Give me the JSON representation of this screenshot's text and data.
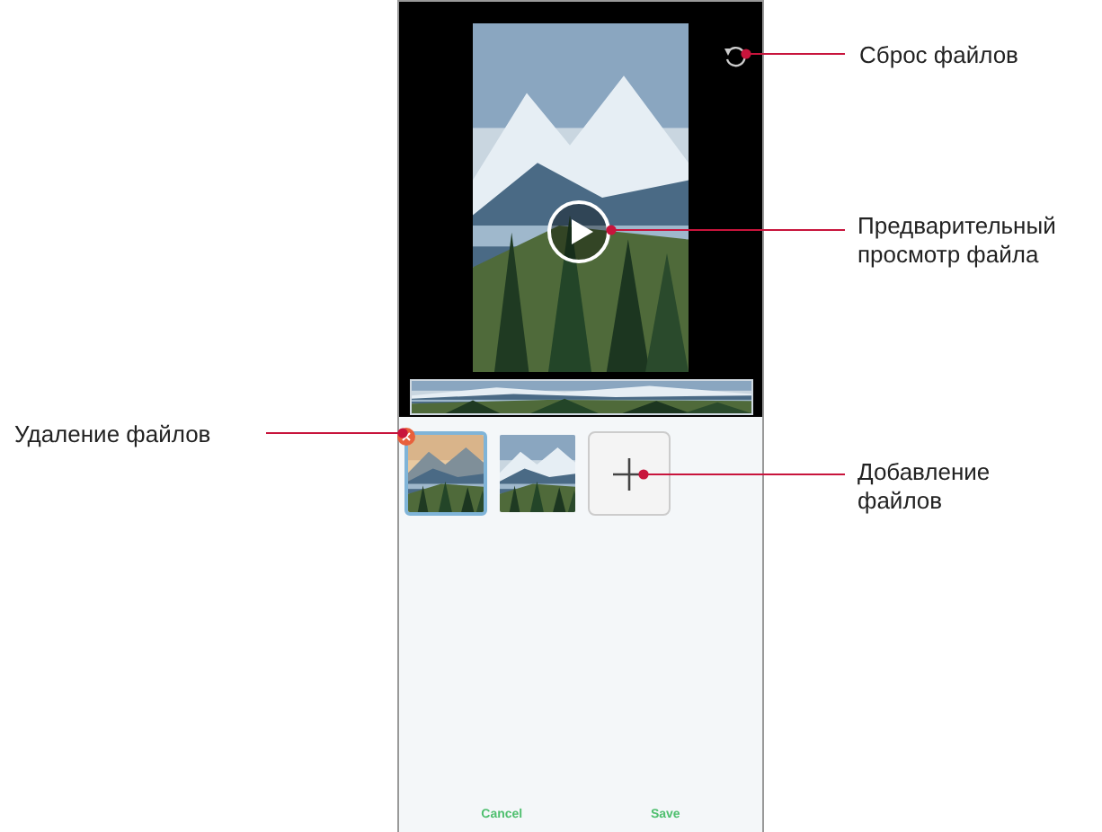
{
  "editor": {
    "files": [
      {
        "kind": "picture",
        "selected": true
      },
      {
        "kind": "picture",
        "selected": false
      }
    ],
    "buttons": [
      {
        "label": "Cancel"
      },
      {
        "label": "Save"
      }
    ]
  },
  "callouts": [
    {
      "text": "Сброс файлов"
    },
    {
      "text": "Предварительный\nпросмотр файла"
    },
    {
      "text": "Удаление файлов"
    },
    {
      "text": "Добавление\nфайлов"
    }
  ]
}
